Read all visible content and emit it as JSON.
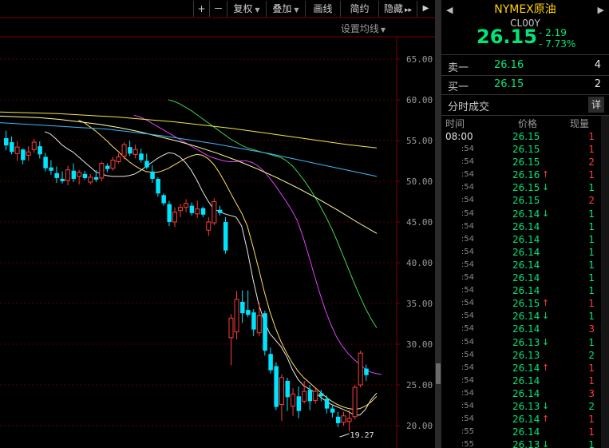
{
  "toolbar": {
    "plus": "+",
    "minus": "－",
    "fuquan": "复权",
    "diejia": "叠加",
    "huaxian": "画线",
    "jianyue": "简约",
    "yincang": "隐藏",
    "more": "▸▸",
    "last": "▶"
  },
  "ma_setting": "设置均线",
  "min_label": "19.27",
  "quote": {
    "name": "NYMEX原油",
    "code": "CL00Y",
    "price": "26.15",
    "change": "- 2.19",
    "change_pct": "- 7.73%",
    "prev_arrow": "◀",
    "next_arrow": "▶"
  },
  "order_book": {
    "sell_label": "卖一",
    "sell_price": "26.16",
    "sell_qty": "4",
    "buy_label": "买一",
    "buy_price": "26.15",
    "buy_qty": "2"
  },
  "ticks_title": "分时成交",
  "detail_label": "详",
  "columns": {
    "time": "时间",
    "price": "价格",
    "volume": "现量"
  },
  "ticks": [
    {
      "time": "08:00",
      "price": "26.15",
      "arrow": "",
      "vol": "1",
      "dir": "up"
    },
    {
      "time": ":54",
      "price": "26.15",
      "arrow": "",
      "vol": "1",
      "dir": "up"
    },
    {
      "time": ":54",
      "price": "26.15",
      "arrow": "",
      "vol": "2",
      "dir": "up"
    },
    {
      "time": ":54",
      "price": "26.16",
      "arrow": "↑",
      "vol": "1",
      "dir": "up"
    },
    {
      "time": ":54",
      "price": "26.15",
      "arrow": "↓",
      "vol": "1",
      "dir": "dn"
    },
    {
      "time": ":54",
      "price": "26.15",
      "arrow": "",
      "vol": "2",
      "dir": "up"
    },
    {
      "time": ":54",
      "price": "26.14",
      "arrow": "↓",
      "vol": "1",
      "dir": "dn"
    },
    {
      "time": ":54",
      "price": "26.14",
      "arrow": "",
      "vol": "1",
      "dir": "dn"
    },
    {
      "time": ":54",
      "price": "26.14",
      "arrow": "",
      "vol": "1",
      "dir": "dn"
    },
    {
      "time": ":54",
      "price": "26.14",
      "arrow": "",
      "vol": "1",
      "dir": "dn"
    },
    {
      "time": ":54",
      "price": "26.14",
      "arrow": "",
      "vol": "1",
      "dir": "dn"
    },
    {
      "time": ":54",
      "price": "26.14",
      "arrow": "",
      "vol": "1",
      "dir": "dn"
    },
    {
      "time": ":54",
      "price": "26.14",
      "arrow": "",
      "vol": "1",
      "dir": "dn"
    },
    {
      "time": ":54",
      "price": "26.15",
      "arrow": "↑",
      "vol": "1",
      "dir": "up"
    },
    {
      "time": ":54",
      "price": "26.14",
      "arrow": "↓",
      "vol": "1",
      "dir": "dn"
    },
    {
      "time": ":54",
      "price": "26.14",
      "arrow": "",
      "vol": "3",
      "dir": "up"
    },
    {
      "time": ":54",
      "price": "26.13",
      "arrow": "↓",
      "vol": "1",
      "dir": "dn"
    },
    {
      "time": ":54",
      "price": "26.13",
      "arrow": "",
      "vol": "2",
      "dir": "dn"
    },
    {
      "time": ":54",
      "price": "26.14",
      "arrow": "↑",
      "vol": "1",
      "dir": "up"
    },
    {
      "time": ":54",
      "price": "26.14",
      "arrow": "",
      "vol": "1",
      "dir": "up"
    },
    {
      "time": ":54",
      "price": "26.14",
      "arrow": "",
      "vol": "3",
      "dir": "up"
    },
    {
      "time": ":54",
      "price": "26.13",
      "arrow": "↓",
      "vol": "2",
      "dir": "dn"
    },
    {
      "time": ":54",
      "price": "26.14",
      "arrow": "↑",
      "vol": "1",
      "dir": "up"
    },
    {
      "time": ":55",
      "price": "26.14",
      "arrow": "",
      "vol": "1",
      "dir": "up"
    },
    {
      "time": ":55",
      "price": "26.13",
      "arrow": "↓",
      "vol": "1",
      "dir": "dn"
    }
  ],
  "colors": {
    "up": "#ff3b3b",
    "down": "#00e5ff",
    "price_down": "#00e676"
  },
  "chart_data": {
    "type": "candlestick",
    "y_ticks": [
      "65.00",
      "60.00",
      "55.00",
      "50.00",
      "45.00",
      "40.00",
      "35.00",
      "30.00",
      "25.00",
      "20.00"
    ],
    "ylim": [
      18.5,
      67.5
    ],
    "grid": true,
    "candles": [
      {
        "o": 55.3,
        "h": 56.2,
        "l": 53.8,
        "c": 54.4
      },
      {
        "o": 54.8,
        "h": 55.5,
        "l": 53.3,
        "c": 53.6
      },
      {
        "o": 53.4,
        "h": 54.9,
        "l": 52.5,
        "c": 54.2
      },
      {
        "o": 53.9,
        "h": 54.0,
        "l": 52.1,
        "c": 52.6
      },
      {
        "o": 53.2,
        "h": 54.3,
        "l": 52.5,
        "c": 53.6
      },
      {
        "o": 53.9,
        "h": 55.2,
        "l": 53.5,
        "c": 54.8
      },
      {
        "o": 54.3,
        "h": 54.9,
        "l": 52.8,
        "c": 53.3
      },
      {
        "o": 53.0,
        "h": 53.5,
        "l": 51.2,
        "c": 51.6
      },
      {
        "o": 51.7,
        "h": 52.6,
        "l": 50.8,
        "c": 51.3
      },
      {
        "o": 51.0,
        "h": 51.8,
        "l": 49.8,
        "c": 50.4
      },
      {
        "o": 50.3,
        "h": 51.2,
        "l": 49.7,
        "c": 50.0
      },
      {
        "o": 50.1,
        "h": 51.9,
        "l": 49.5,
        "c": 51.4
      },
      {
        "o": 51.3,
        "h": 52.2,
        "l": 49.9,
        "c": 50.3
      },
      {
        "o": 50.6,
        "h": 51.4,
        "l": 49.6,
        "c": 51.1
      },
      {
        "o": 50.9,
        "h": 51.3,
        "l": 50.2,
        "c": 50.4
      },
      {
        "o": 49.9,
        "h": 50.9,
        "l": 49.6,
        "c": 50.5
      },
      {
        "o": 50.5,
        "h": 51.4,
        "l": 49.9,
        "c": 50.2
      },
      {
        "o": 50.4,
        "h": 52.4,
        "l": 50.0,
        "c": 52.2
      },
      {
        "o": 51.9,
        "h": 52.2,
        "l": 51.1,
        "c": 51.5
      },
      {
        "o": 51.6,
        "h": 53.0,
        "l": 51.3,
        "c": 52.6
      },
      {
        "o": 52.4,
        "h": 53.4,
        "l": 52.2,
        "c": 53.0
      },
      {
        "o": 53.1,
        "h": 54.8,
        "l": 52.7,
        "c": 54.5
      },
      {
        "o": 54.2,
        "h": 55.0,
        "l": 53.1,
        "c": 53.4
      },
      {
        "o": 53.3,
        "h": 54.5,
        "l": 52.8,
        "c": 53.9
      },
      {
        "o": 53.4,
        "h": 54.0,
        "l": 52.3,
        "c": 52.6
      },
      {
        "o": 52.5,
        "h": 53.4,
        "l": 51.5,
        "c": 51.7
      },
      {
        "o": 51.2,
        "h": 52.0,
        "l": 49.8,
        "c": 50.3
      },
      {
        "o": 50.3,
        "h": 50.5,
        "l": 48.1,
        "c": 48.5
      },
      {
        "o": 48.3,
        "h": 48.5,
        "l": 47.0,
        "c": 47.3
      },
      {
        "o": 47.2,
        "h": 47.6,
        "l": 44.5,
        "c": 45.0
      },
      {
        "o": 45.0,
        "h": 46.8,
        "l": 44.4,
        "c": 46.2
      },
      {
        "o": 46.4,
        "h": 47.2,
        "l": 45.6,
        "c": 46.8
      },
      {
        "o": 46.8,
        "h": 47.8,
        "l": 46.2,
        "c": 47.3
      },
      {
        "o": 47.0,
        "h": 47.4,
        "l": 45.8,
        "c": 46.1
      },
      {
        "o": 46.0,
        "h": 47.6,
        "l": 45.5,
        "c": 46.6
      },
      {
        "o": 46.7,
        "h": 46.9,
        "l": 45.6,
        "c": 45.9
      },
      {
        "o": 44.0,
        "h": 45.6,
        "l": 43.3,
        "c": 45.0
      },
      {
        "o": 44.9,
        "h": 47.9,
        "l": 44.6,
        "c": 47.5
      },
      {
        "o": 46.5,
        "h": 47.0,
        "l": 45.8,
        "c": 46.1
      },
      {
        "o": 45.0,
        "h": 45.6,
        "l": 41.1,
        "c": 41.5
      },
      {
        "o": 30.8,
        "h": 33.7,
        "l": 27.4,
        "c": 33.2
      },
      {
        "o": 31.5,
        "h": 36.5,
        "l": 30.6,
        "c": 35.5
      },
      {
        "o": 35.2,
        "h": 36.6,
        "l": 32.6,
        "c": 33.8
      },
      {
        "o": 34.2,
        "h": 36.6,
        "l": 33.3,
        "c": 33.6
      },
      {
        "o": 33.9,
        "h": 34.3,
        "l": 31.0,
        "c": 31.8
      },
      {
        "o": 31.4,
        "h": 35.1,
        "l": 31.0,
        "c": 33.5
      },
      {
        "o": 33.8,
        "h": 34.1,
        "l": 28.6,
        "c": 29.2
      },
      {
        "o": 28.8,
        "h": 29.6,
        "l": 26.4,
        "c": 26.8
      },
      {
        "o": 27.3,
        "h": 27.8,
        "l": 21.9,
        "c": 22.3
      },
      {
        "o": 22.6,
        "h": 26.3,
        "l": 20.6,
        "c": 25.9
      },
      {
        "o": 25.5,
        "h": 25.9,
        "l": 21.8,
        "c": 23.5
      },
      {
        "o": 22.4,
        "h": 24.6,
        "l": 21.2,
        "c": 23.9
      },
      {
        "o": 23.6,
        "h": 24.8,
        "l": 20.9,
        "c": 21.8
      },
      {
        "o": 23.0,
        "h": 25.5,
        "l": 22.7,
        "c": 24.2
      },
      {
        "o": 24.4,
        "h": 25.0,
        "l": 21.9,
        "c": 23.0
      },
      {
        "o": 23.1,
        "h": 24.6,
        "l": 22.7,
        "c": 24.2
      },
      {
        "o": 24.0,
        "h": 24.4,
        "l": 23.0,
        "c": 23.6
      },
      {
        "o": 23.3,
        "h": 23.7,
        "l": 21.5,
        "c": 22.1
      },
      {
        "o": 22.1,
        "h": 22.6,
        "l": 21.0,
        "c": 21.6
      },
      {
        "o": 21.1,
        "h": 21.7,
        "l": 19.8,
        "c": 20.3
      },
      {
        "o": 20.4,
        "h": 21.7,
        "l": 20.0,
        "c": 21.2
      },
      {
        "o": 20.5,
        "h": 21.9,
        "l": 19.3,
        "c": 20.9
      },
      {
        "o": 21.1,
        "h": 25.0,
        "l": 20.8,
        "c": 24.7
      },
      {
        "o": 25.0,
        "h": 29.2,
        "l": 24.7,
        "c": 28.9
      },
      {
        "o": 27.0,
        "h": 27.5,
        "l": 25.5,
        "c": 26.2
      }
    ],
    "ma_series": [
      {
        "color": "#e8e8e8",
        "values": [
          56.1,
          55.8,
          55.2,
          54.5,
          54.0,
          53.6,
          53.0,
          52.4,
          51.8,
          51.2,
          50.9,
          50.7,
          50.6,
          50.6,
          50.6,
          50.7,
          50.9,
          51.3,
          51.8,
          52.3,
          52.8,
          53.2,
          53.5,
          53.4,
          53.0,
          52.3,
          51.4,
          50.2,
          48.8,
          47.6,
          46.6,
          46.3,
          46.0,
          45.8,
          45.6,
          44.5,
          41.5,
          38.0,
          35.0,
          32.8,
          31.3,
          30.5,
          29.7,
          28.5,
          26.9,
          25.7,
          24.9,
          24.5,
          24.1,
          23.5,
          23.0,
          22.6,
          22.3,
          22.0,
          21.7,
          21.3,
          21.3,
          22.0,
          23.2,
          24.0
        ]
      },
      {
        "color": "#ffe066",
        "values": [
          57.5,
          57.2,
          56.7,
          56.2,
          55.6,
          55.0,
          54.3,
          53.7,
          53.0,
          52.4,
          51.9,
          51.5,
          51.2,
          51.1,
          51.1,
          51.3,
          51.6,
          52.0,
          52.4,
          52.8,
          53.1,
          53.3,
          53.2,
          52.8,
          52.1,
          51.1,
          49.9,
          48.6,
          47.3,
          46.1,
          44.5,
          42.0,
          39.3,
          36.5,
          34.0,
          32.0,
          30.3,
          28.9,
          27.7,
          26.7,
          25.9,
          25.3,
          24.7,
          24.1,
          23.5,
          23.0,
          22.6,
          22.3,
          22.1,
          22.0,
          22.1,
          22.4,
          22.9,
          23.6
        ]
      },
      {
        "color": "#e040fb",
        "values": [
          58.1,
          57.9,
          57.6,
          57.2,
          56.8,
          56.4,
          56.0,
          55.6,
          55.2,
          54.8,
          54.4,
          54.0,
          53.6,
          53.2,
          52.9,
          52.7,
          52.5,
          52.4,
          52.4,
          52.5,
          52.5,
          52.3,
          51.9,
          51.3,
          50.5,
          49.6,
          48.6,
          47.6,
          46.5,
          45.2,
          43.3,
          41.0,
          38.6,
          36.3,
          34.2,
          32.4,
          30.9,
          29.8,
          28.9,
          28.2,
          27.6,
          27.0,
          26.6,
          26.4,
          26.3
        ]
      },
      {
        "color": "#3dd64a",
        "values": [
          60.0,
          59.8,
          59.5,
          59.1,
          58.7,
          58.2,
          57.7,
          57.2,
          56.7,
          56.2,
          55.7,
          55.2,
          54.8,
          54.4,
          54.1,
          53.9,
          53.7,
          53.5,
          53.3,
          53.1,
          52.9,
          52.5,
          51.9,
          51.1,
          50.2,
          49.2,
          48.1,
          46.9,
          45.6,
          44.2,
          42.6,
          40.9,
          39.2,
          37.5,
          35.9,
          34.4,
          33.1,
          32.0
        ]
      },
      {
        "color": "#ffffa0",
        "values": [
          58.0,
          57.9,
          57.8,
          57.6,
          57.3,
          57.0,
          56.6,
          56.1,
          55.5,
          54.9,
          54.2,
          53.4,
          52.5,
          51.5,
          50.4,
          49.2,
          47.9,
          46.5,
          45.0,
          43.6
        ]
      },
      {
        "color": "#3fb7ff",
        "values": [
          57.2,
          57.0,
          56.8,
          56.6,
          56.4,
          56.0,
          55.6,
          55.1,
          54.6,
          54.0,
          53.4,
          52.7,
          52.0,
          51.3,
          50.6
        ]
      },
      {
        "color": "#f5e642",
        "values": [
          58.5,
          58.4,
          58.3,
          58.1,
          57.9,
          57.6,
          57.3,
          56.9,
          56.5,
          56.0,
          55.5,
          55.0,
          54.5,
          54.1
        ]
      }
    ]
  }
}
